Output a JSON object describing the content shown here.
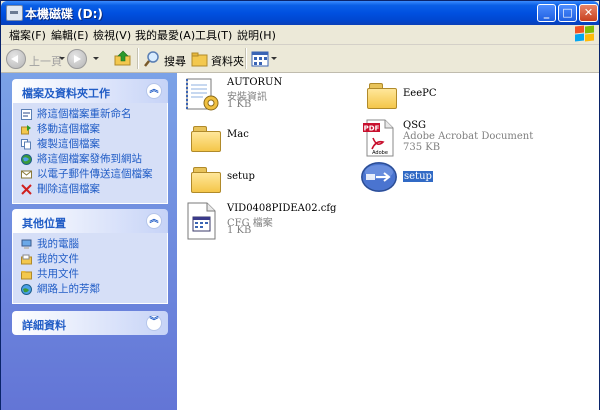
{
  "window": {
    "title": "本機磁碟 (D:)",
    "controls": {
      "minimize": "_",
      "maximize": "□",
      "close": "✕"
    }
  },
  "menu": [
    "檔案(F)",
    "編輯(E)",
    "檢視(V)",
    "我的最愛(A)",
    "工具(T)",
    "說明(H)"
  ],
  "toolbar": {
    "back_label": "上一頁",
    "search_label": "搜尋",
    "folders_label": "資料夾"
  },
  "sidebar": {
    "tasks": {
      "title": "檔案及資料夾工作",
      "items": [
        {
          "label": "將這個檔案重新命名",
          "icon": "rename-icon"
        },
        {
          "label": "移動這個檔案",
          "icon": "move-icon"
        },
        {
          "label": "複製這個檔案",
          "icon": "copy-icon"
        },
        {
          "label": "將這個檔案發佈到網站",
          "icon": "publish-icon"
        },
        {
          "label": "以電子郵件傳送這個檔案",
          "icon": "email-icon"
        },
        {
          "label": "刪除這個檔案",
          "icon": "delete-icon"
        }
      ]
    },
    "places": {
      "title": "其他位置",
      "items": [
        {
          "label": "我的電腦",
          "icon": "my-computer-icon"
        },
        {
          "label": "我的文件",
          "icon": "my-documents-icon"
        },
        {
          "label": "共用文件",
          "icon": "shared-documents-icon"
        },
        {
          "label": "網路上的芳鄰",
          "icon": "network-icon"
        }
      ]
    },
    "details": {
      "title": "詳細資料"
    }
  },
  "files": [
    {
      "name": "AUTORUN",
      "type": "安裝資訊",
      "size": "1 KB",
      "icon": "setup-info-icon"
    },
    {
      "name": "EeePC",
      "icon": "folder-icon"
    },
    {
      "name": "Mac",
      "icon": "folder-icon"
    },
    {
      "name": "QSG",
      "type": "Adobe Acrobat Document",
      "size": "735 KB",
      "icon": "pdf-icon",
      "badge": "PDF",
      "brand": "Adobe"
    },
    {
      "name": "setup",
      "icon": "folder-icon"
    },
    {
      "name": "setup",
      "icon": "setup-exe-icon",
      "selected": true
    },
    {
      "name": "VID0408PIDEA02.cfg",
      "type": "CFG 檔案",
      "size": "1 KB",
      "icon": "cfg-file-icon"
    }
  ],
  "colors": {
    "titlebar": "#0050e0",
    "sidebar_bg": "#6f8be0",
    "task_link": "#215dc6",
    "selection": "#316ac5"
  }
}
